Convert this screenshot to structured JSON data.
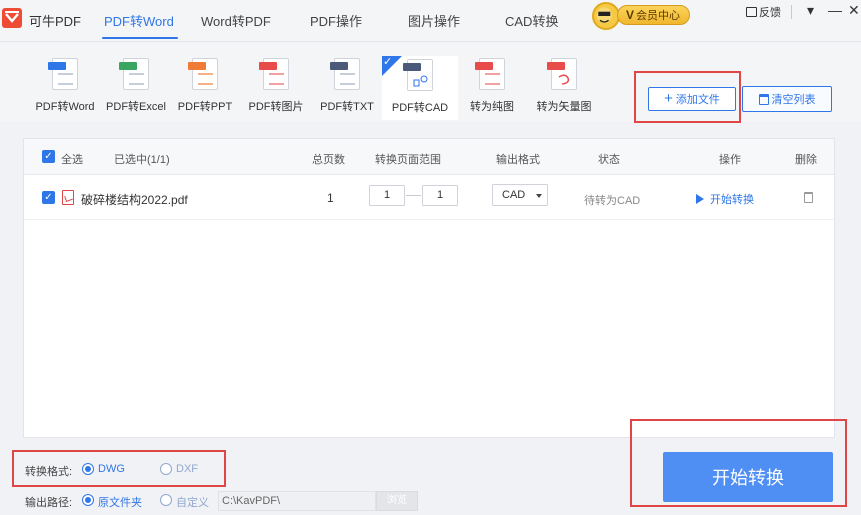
{
  "app": {
    "title": "可牛PDF"
  },
  "nav": {
    "tabs": [
      {
        "label": "PDF转Word",
        "active": true
      },
      {
        "label": "Word转PDF",
        "active": false
      },
      {
        "label": "PDF操作",
        "active": false
      },
      {
        "label": "图片操作",
        "active": false
      },
      {
        "label": "CAD转换",
        "active": false
      }
    ],
    "vip_badge": "V",
    "vip_label": "会员中心",
    "feedback": "反馈",
    "window_controls": {
      "menu": "▾",
      "minimize": "—",
      "close": "✕"
    }
  },
  "tools": [
    {
      "label": "PDF转Word",
      "icon": "docx-icon",
      "tag_color": "#2f76e8"
    },
    {
      "label": "PDF转Excel",
      "icon": "xlsx-icon",
      "tag_color": "#3aa55f"
    },
    {
      "label": "PDF转PPT",
      "icon": "ppt-icon",
      "tag_color": "#f07b36"
    },
    {
      "label": "PDF转图片",
      "icon": "jpg-icon",
      "tag_color": "#e94a4a"
    },
    {
      "label": "PDF转TXT",
      "icon": "txt-icon",
      "tag_color": "#4a5a78"
    },
    {
      "label": "PDF转CAD",
      "icon": "dwg-icon",
      "tag_color": "#4a5a78",
      "active": true
    },
    {
      "label": "转为纯图",
      "icon": "pdf-image-icon",
      "tag_color": "#e94a4a"
    },
    {
      "label": "转为矢量图",
      "icon": "pdf-vector-icon",
      "tag_color": "#e94a4a"
    }
  ],
  "actions": {
    "add_file": "添加文件",
    "clear_list": "清空列表"
  },
  "table": {
    "headers": {
      "select_all": "全选",
      "selected": "已选中(1/1)",
      "total_pages": "总页数",
      "page_range": "转换页面范围",
      "output_format": "输出格式",
      "status": "状态",
      "operation": "操作",
      "delete": "删除"
    },
    "rows": [
      {
        "file_name": "破碎楼结构2022.pdf",
        "total_pages": "1",
        "range_from": "1",
        "range_to": "1",
        "format": "CAD",
        "status": "待转为CAD",
        "action": "开始转换"
      }
    ]
  },
  "bottom": {
    "format_label": "转换格式:",
    "format_options": [
      "DWG",
      "DXF"
    ],
    "format_selected": "DWG",
    "path_label": "输出路径:",
    "path_options": [
      "原文件夹",
      "自定义"
    ],
    "path_selected": "原文件夹",
    "path_value": "C:\\KavPDF\\",
    "browse": "浏览",
    "start_button": "开始转换"
  },
  "colors": {
    "accent": "#2f76e8",
    "highlight_box": "#e04646",
    "start_button": "#4f8ef2"
  }
}
